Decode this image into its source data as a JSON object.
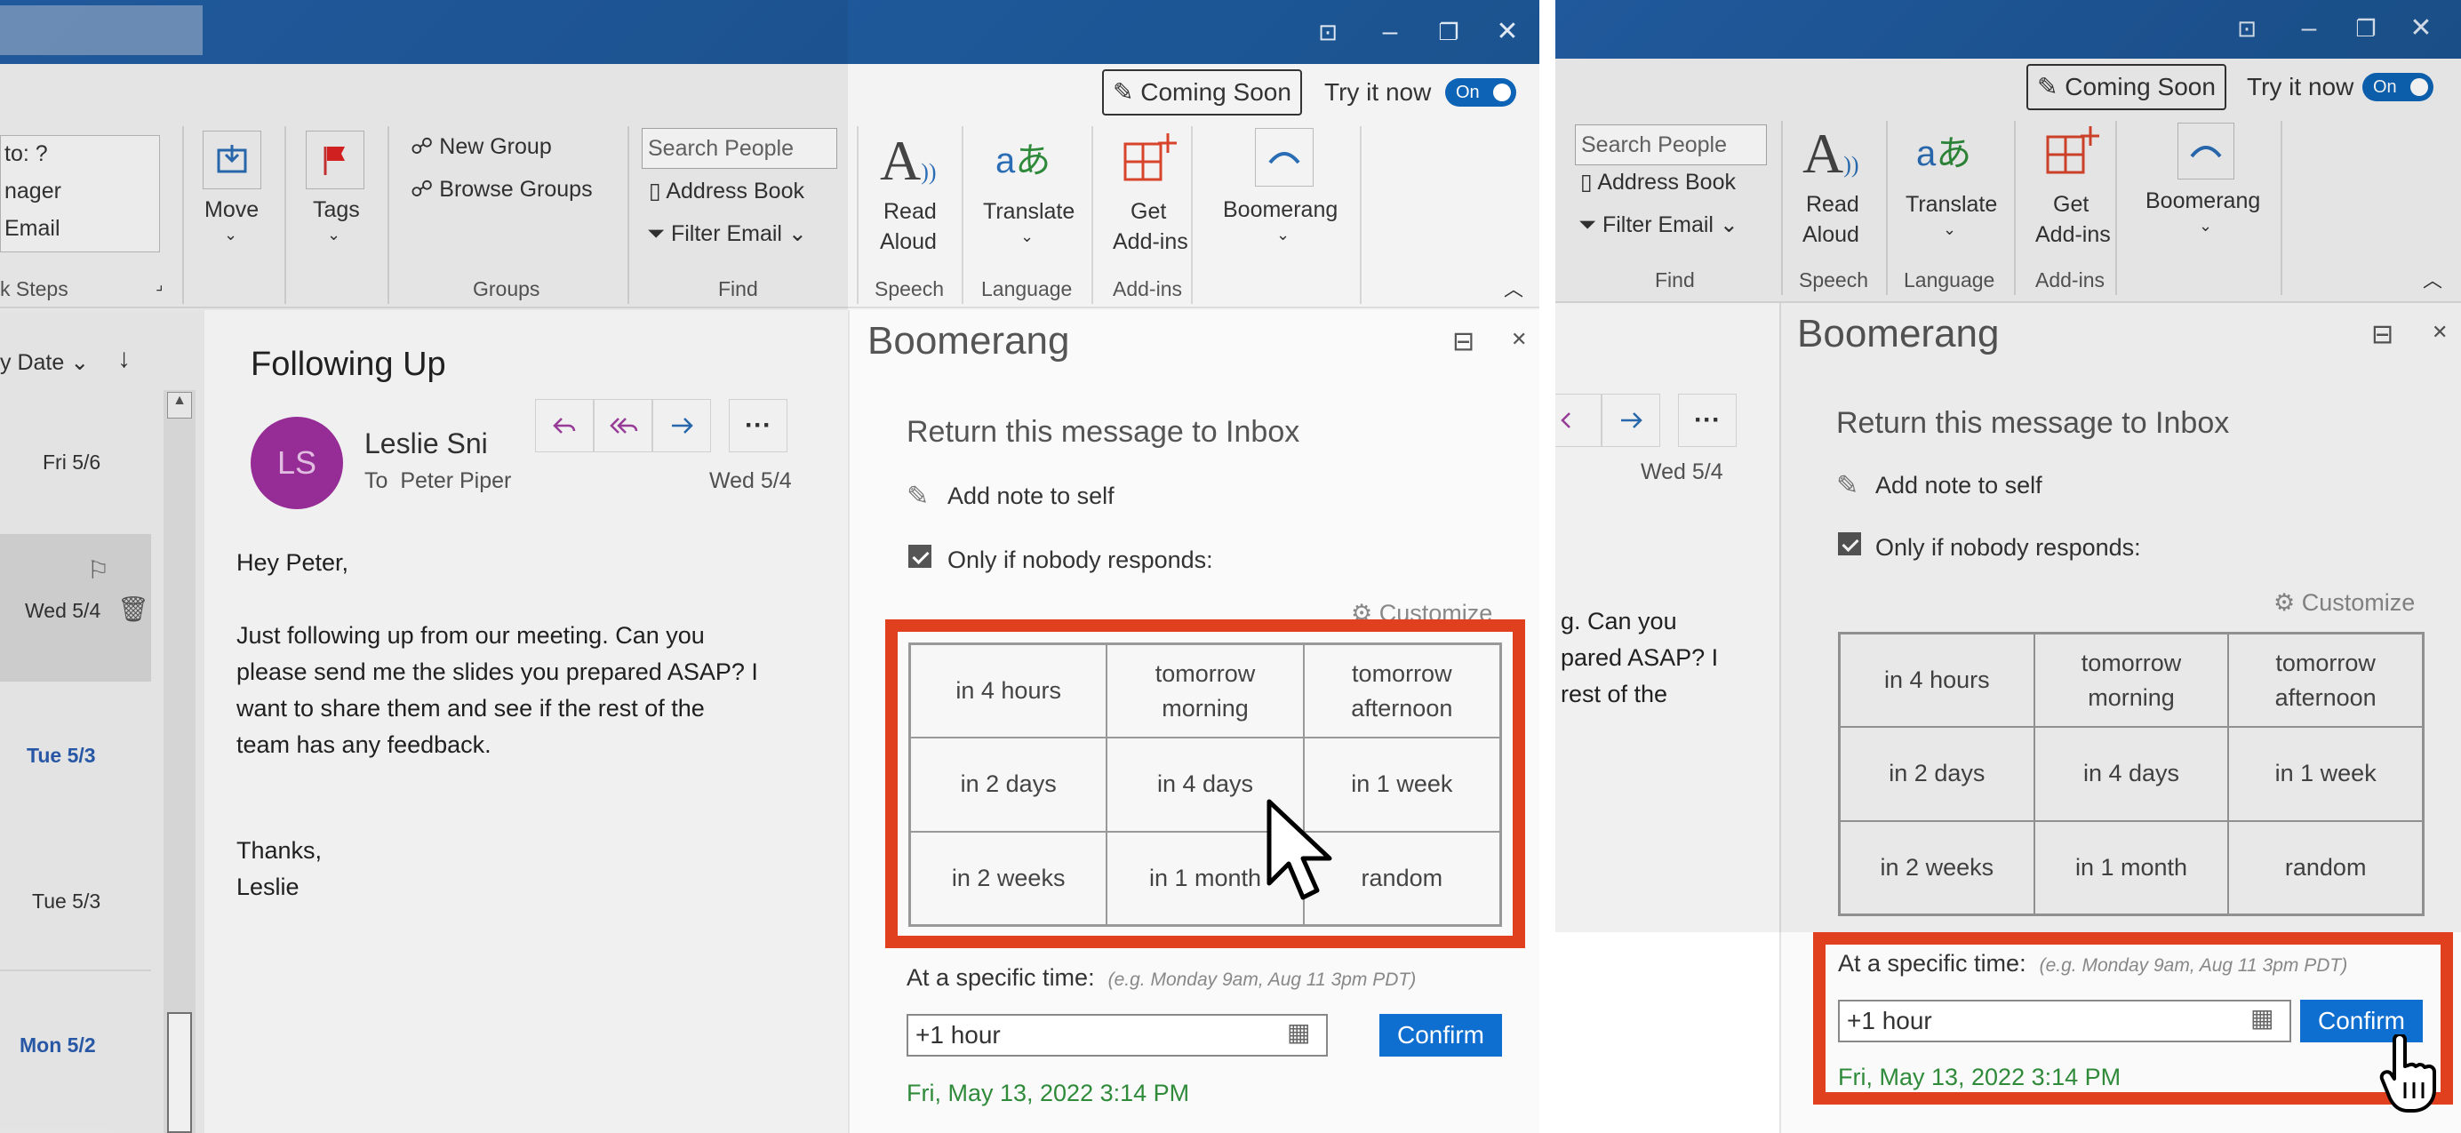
{
  "left": {
    "ribbon": {
      "coming_soon": "Coming Soon",
      "try_it_now": "Try it now",
      "toggle": "On",
      "quick_steps": [
        "to: ?",
        "nager",
        "Email"
      ],
      "quick_steps_label": "k Steps",
      "move": "Move",
      "tags": "Tags",
      "new_group": "New Group",
      "browse_groups": "Browse Groups",
      "groups_label": "Groups",
      "search_people": "Search People",
      "address_book": "Address Book",
      "filter_email": "Filter Email",
      "find_label": "Find",
      "read_aloud_1": "Read",
      "read_aloud_2": "Aloud",
      "speech_label": "Speech",
      "translate": "Translate",
      "language_label": "Language",
      "get_addins_1": "Get",
      "get_addins_2": "Add-ins",
      "addins_label": "Add-ins",
      "boomerang": "Boomerang"
    },
    "list": {
      "sort": "y Date",
      "items": [
        "Fri 5/6",
        "Wed 5/4",
        "Tue 5/3",
        "Tue 5/3",
        "Mon 5/2"
      ]
    },
    "message": {
      "subject": "Following Up",
      "avatar": "LS",
      "sender": "Leslie Sni",
      "to_label": "To",
      "to": "Peter Piper",
      "date": "Wed 5/4",
      "greeting": "Hey Peter,",
      "body_1": "Just following up from our meeting. Can you",
      "body_2": "please send me the slides you prepared ASAP? I",
      "body_3": "want to share them and see if the rest of the",
      "body_4": "team has any feedback.",
      "closing_1": "Thanks,",
      "closing_2": "Leslie"
    },
    "boomerang": {
      "title": "Boomerang",
      "return_label": "Return this message to Inbox",
      "add_note": "Add note to self",
      "only_if": "Only if nobody responds:",
      "customize": "Customize",
      "options": [
        [
          "in 4 hours",
          "tomorrow morning",
          "tomorrow afternoon"
        ],
        [
          "in 2 days",
          "in 4 days",
          "in 1 week"
        ],
        [
          "in 2 weeks",
          "in 1 month",
          "random"
        ]
      ],
      "specific_time_label": "At a specific time:",
      "specific_time_hint": "(e.g. Monday 9am, Aug 11 3pm PDT)",
      "time_value": "+1 hour",
      "confirm": "Confirm",
      "result": "Fri, May 13, 2022 3:14 PM"
    }
  },
  "right": {
    "ribbon": {
      "coming_soon": "Coming Soon",
      "try_it_now": "Try it now",
      "toggle": "On",
      "search_people": "Search People",
      "address_book": "Address Book",
      "filter_email": "Filter Email",
      "find_label": "Find",
      "read_aloud_1": "Read",
      "read_aloud_2": "Aloud",
      "speech_label": "Speech",
      "translate": "Translate",
      "language_label": "Language",
      "get_addins_1": "Get",
      "get_addins_2": "Add-ins",
      "addins_label": "Add-ins",
      "boomerang": "Boomerang"
    },
    "message": {
      "date": "Wed 5/4",
      "body_1": "g. Can you",
      "body_2": "pared ASAP? I",
      "body_3": "rest of the"
    },
    "boomerang": {
      "title": "Boomerang",
      "return_label": "Return this message to Inbox",
      "add_note": "Add note to self",
      "only_if": "Only if nobody responds:",
      "customize": "Customize",
      "options": [
        [
          "in 4 hours",
          "tomorrow morning",
          "tomorrow afternoon"
        ],
        [
          "in 2 days",
          "in 4 days",
          "in 1 week"
        ],
        [
          "in 2 weeks",
          "in 1 month",
          "random"
        ]
      ],
      "specific_time_label": "At a specific time:",
      "specific_time_hint": "(e.g. Monday 9am, Aug 11 3pm PDT)",
      "time_value": "+1 hour",
      "confirm": "Confirm",
      "result": "Fri, May 13, 2022 3:14 PM"
    }
  },
  "colors": {
    "titlebar": "#1e5aa0",
    "highlight": "#e1401f",
    "confirm": "#0f6fd0",
    "result": "#2f8a3a",
    "avatar": "#a030a0"
  }
}
